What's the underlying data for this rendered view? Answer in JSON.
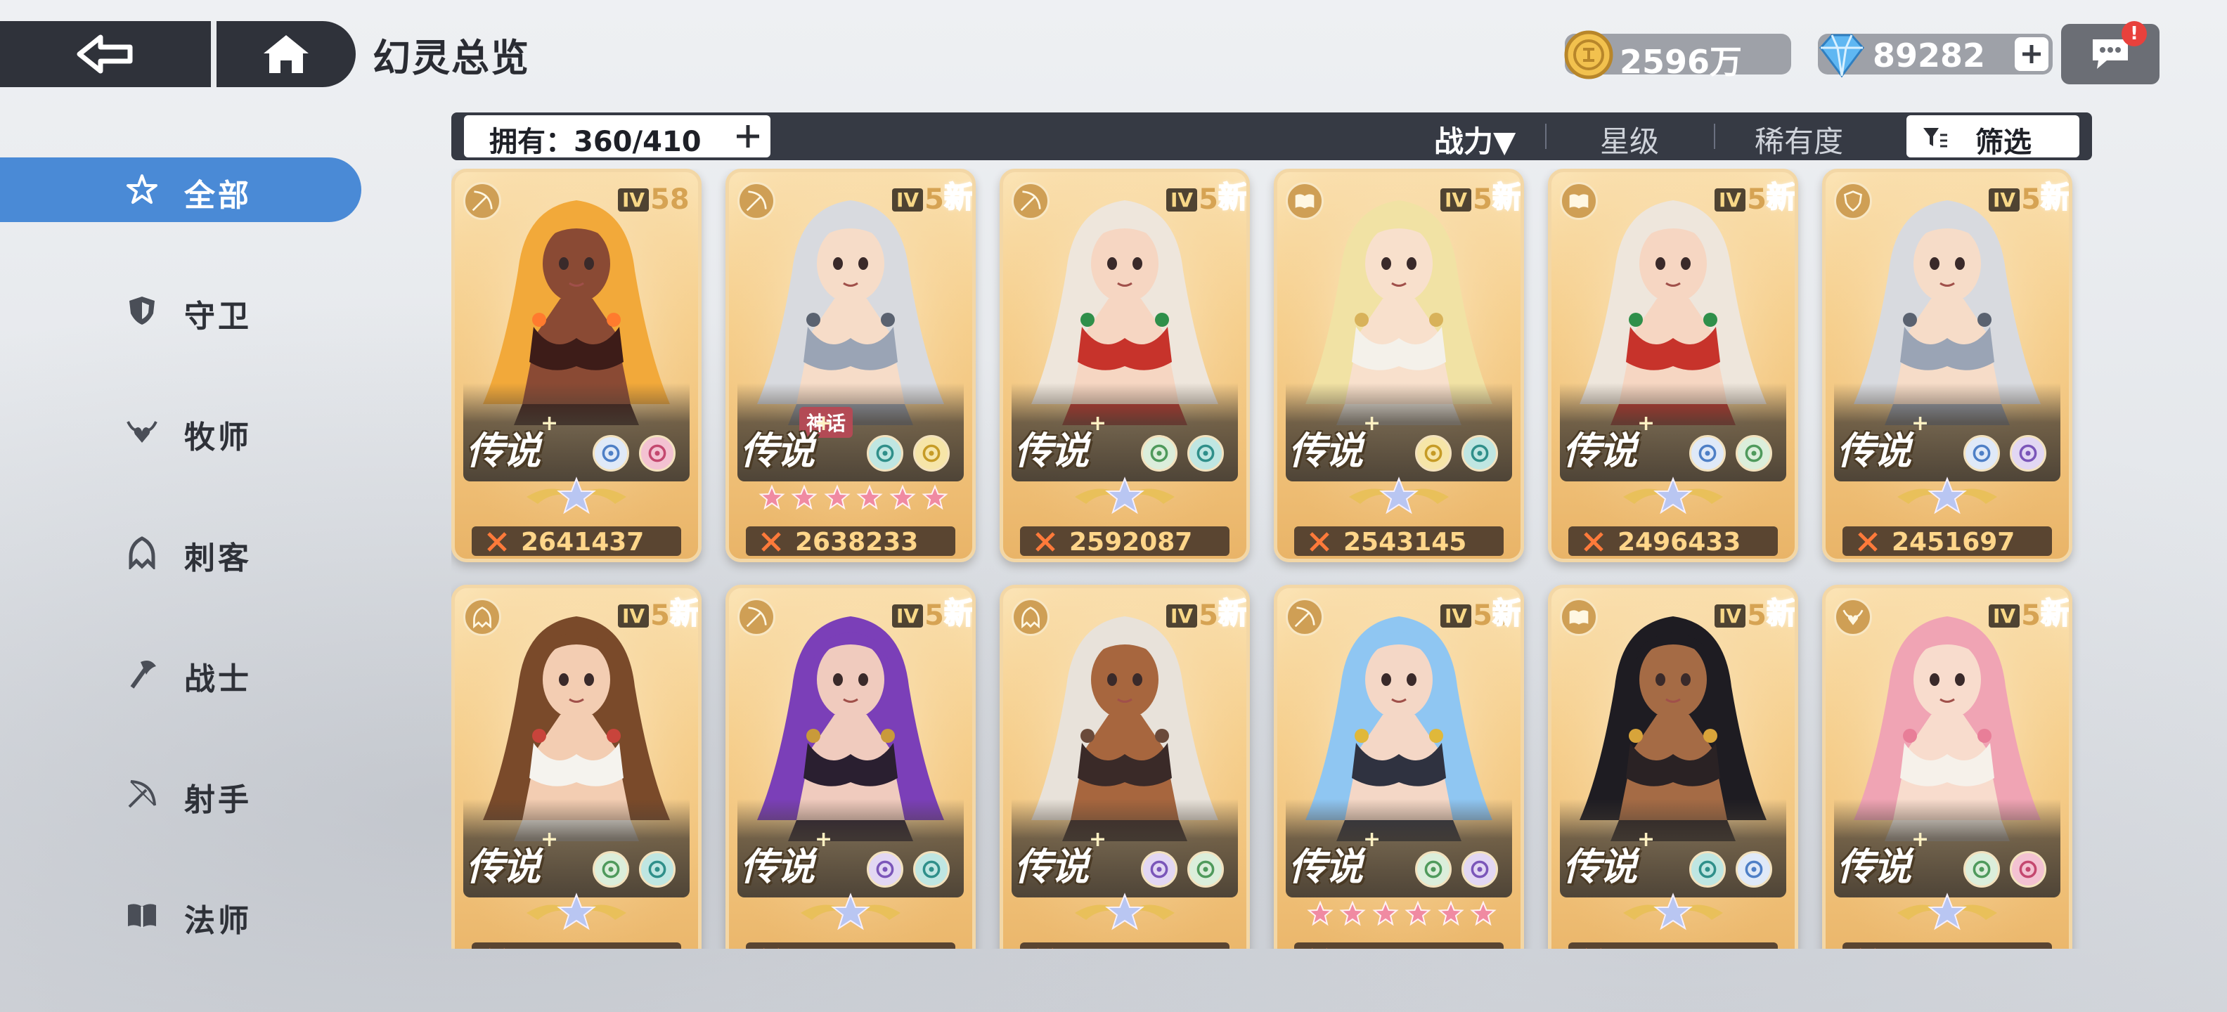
{
  "header": {
    "title": "幻灵总览",
    "gold": "2596万",
    "gems": "89282",
    "chat_badge": "!"
  },
  "sidebar": {
    "items": [
      {
        "label": "全部",
        "icon": "star-burst-icon",
        "active": true
      },
      {
        "label": "守卫",
        "icon": "shield-icon"
      },
      {
        "label": "牧师",
        "icon": "wing-heart-icon"
      },
      {
        "label": "刺客",
        "icon": "hood-icon"
      },
      {
        "label": "战士",
        "icon": "axe-icon"
      },
      {
        "label": "射手",
        "icon": "bow-icon"
      },
      {
        "label": "法师",
        "icon": "book-icon"
      }
    ]
  },
  "filter_bar": {
    "owned": "拥有：360/410",
    "sort_power": "战力▼",
    "sort_star": "星级",
    "sort_rarity": "稀有度",
    "filter": "筛选"
  },
  "colors": {
    "accent_blue": "#4a8ad6",
    "dark_panel": "#363a44",
    "power_text": "#ffd68a",
    "new_tag": "#ff8a1f"
  },
  "cards": [
    {
      "rarity": "传说",
      "tier": "IV",
      "level": "58",
      "new": "",
      "myth": "",
      "power": "2641437",
      "class_icon": "bow-icon",
      "elements": [
        "star-crystal",
        "spiral"
      ],
      "stars": false,
      "theme": "fire"
    },
    {
      "rarity": "传说",
      "tier": "IV",
      "level": "5",
      "new": "新",
      "myth": "神话",
      "power": "2638233",
      "class_icon": "bow-icon",
      "elements": [
        "teal-orb",
        "gold-wing"
      ],
      "stars": true,
      "theme": "silver"
    },
    {
      "rarity": "传说",
      "tier": "IV",
      "level": "5",
      "new": "新",
      "myth": "",
      "power": "2592087",
      "class_icon": "bow-icon",
      "elements": [
        "leaf",
        "teal-orb"
      ],
      "stars": false,
      "theme": "red"
    },
    {
      "rarity": "传说",
      "tier": "IV",
      "level": "5",
      "new": "新",
      "myth": "",
      "power": "2543145",
      "class_icon": "book-icon",
      "elements": [
        "gold-wing",
        "teal-orb"
      ],
      "stars": false,
      "theme": "white"
    },
    {
      "rarity": "传说",
      "tier": "IV",
      "level": "5",
      "new": "新",
      "myth": "",
      "power": "2496433",
      "class_icon": "book-icon",
      "elements": [
        "star-crystal",
        "leaf"
      ],
      "stars": false,
      "theme": "red"
    },
    {
      "rarity": "传说",
      "tier": "IV",
      "level": "5",
      "new": "新",
      "myth": "",
      "power": "2451697",
      "class_icon": "shield-icon",
      "elements": [
        "star-crystal",
        "violet-gem"
      ],
      "stars": false,
      "theme": "silver"
    },
    {
      "rarity": "传说",
      "tier": "IV",
      "level": "5",
      "new": "新",
      "myth": "",
      "power": "",
      "class_icon": "hood-icon",
      "elements": [
        "leaf",
        "teal-orb"
      ],
      "stars": false,
      "theme": "brown"
    },
    {
      "rarity": "传说",
      "tier": "IV",
      "level": "5",
      "new": "新",
      "myth": "",
      "power": "",
      "class_icon": "bow-icon",
      "elements": [
        "violet-gem",
        "teal-orb"
      ],
      "stars": false,
      "theme": "purple"
    },
    {
      "rarity": "传说",
      "tier": "IV",
      "level": "5",
      "new": "新",
      "myth": "",
      "power": "",
      "class_icon": "hood-icon",
      "elements": [
        "violet-gem",
        "leaf"
      ],
      "stars": false,
      "theme": "tan"
    },
    {
      "rarity": "传说",
      "tier": "IV",
      "level": "58",
      "new": "新",
      "myth": "",
      "power": "",
      "class_icon": "bow-icon",
      "elements": [
        "leaf",
        "violet-gem"
      ],
      "stars": true,
      "theme": "blue"
    },
    {
      "rarity": "传说",
      "tier": "IV",
      "level": "5",
      "new": "新",
      "myth": "",
      "power": "",
      "class_icon": "book-icon",
      "elements": [
        "teal-orb",
        "star-crystal"
      ],
      "stars": false,
      "theme": "black"
    },
    {
      "rarity": "传说",
      "tier": "IV",
      "level": "5",
      "new": "新",
      "myth": "",
      "power": "",
      "class_icon": "wing-heart-icon",
      "elements": [
        "leaf",
        "spiral"
      ],
      "stars": false,
      "theme": "pink"
    }
  ]
}
